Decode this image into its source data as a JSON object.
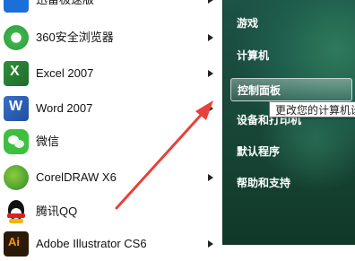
{
  "start_menu": {
    "programs": [
      {
        "label": "迅雷极速版",
        "icon": "thunder-icon",
        "has_submenu": true
      },
      {
        "label": "360安全浏览器",
        "icon": "360-browser-icon",
        "has_submenu": true
      },
      {
        "label": "Excel 2007",
        "icon": "excel-icon",
        "has_submenu": true
      },
      {
        "label": "Word 2007",
        "icon": "word-icon",
        "has_submenu": true
      },
      {
        "label": "微信",
        "icon": "wechat-icon",
        "has_submenu": false
      },
      {
        "label": "CorelDRAW X6",
        "icon": "coreldraw-icon",
        "has_submenu": true
      },
      {
        "label": "腾讯QQ",
        "icon": "qq-icon",
        "has_submenu": false
      },
      {
        "label": "Adobe Illustrator CS6",
        "icon": "illustrator-icon",
        "has_submenu": true
      }
    ],
    "places": [
      {
        "label": "游戏"
      },
      {
        "label": "计算机"
      },
      {
        "label": "控制面板",
        "highlighted": true
      },
      {
        "label": "设备和打印机"
      },
      {
        "label": "默认程序"
      },
      {
        "label": "帮助和支持"
      }
    ],
    "tooltip": "更改您的计算机设置",
    "colors": {
      "right_panel": "#1d5247",
      "annotation_arrow": "#e8403a"
    }
  }
}
